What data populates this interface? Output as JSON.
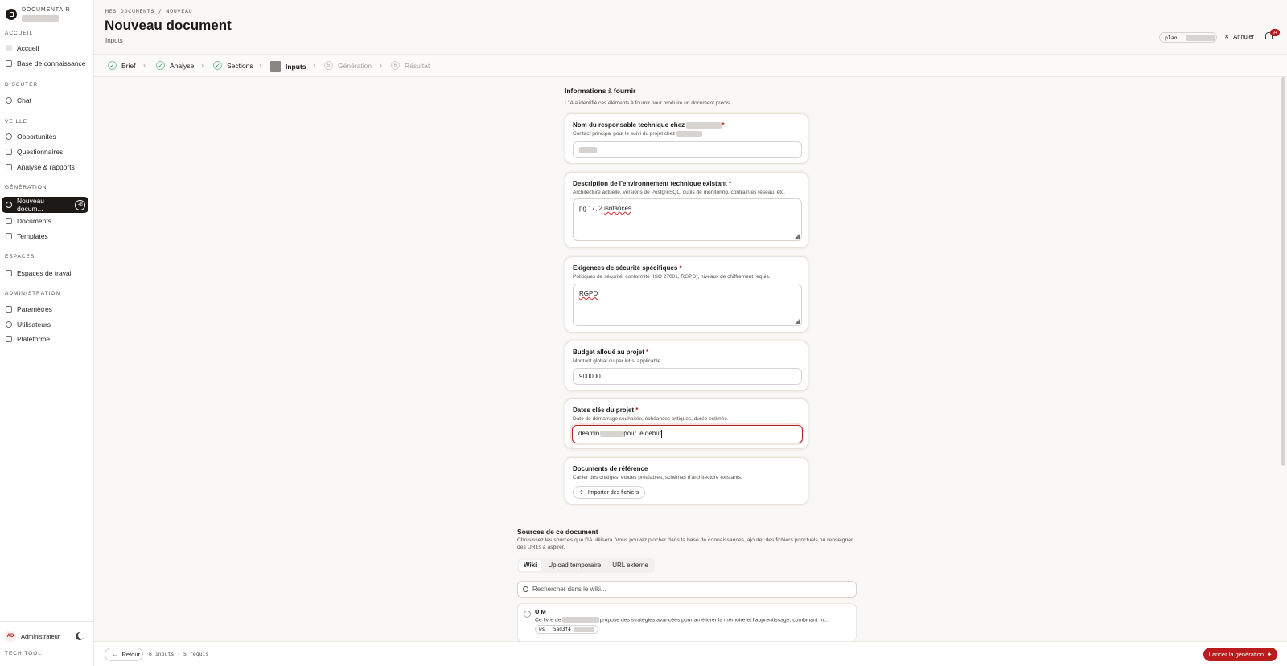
{
  "brand": {
    "name": "DOCUMENTAIR"
  },
  "sidebar": {
    "sections": [
      {
        "title": "ACCUEIL",
        "items": [
          {
            "label": "Accueil"
          },
          {
            "label": "Base de connaissance"
          }
        ]
      },
      {
        "title": "DISCUTER",
        "items": [
          {
            "label": "Chat"
          }
        ]
      },
      {
        "title": "VEILLE",
        "items": [
          {
            "label": "Opportunités"
          },
          {
            "label": "Questionnaires"
          },
          {
            "label": "Analyse & rapports"
          }
        ]
      },
      {
        "title": "GÉNÉRATION",
        "items": [
          {
            "label": "Nouveau docum...",
            "badge": "+8",
            "active": true
          },
          {
            "label": "Documents"
          },
          {
            "label": "Templates"
          }
        ]
      },
      {
        "title": "ESPACES",
        "items": [
          {
            "label": "Espaces de travail"
          }
        ]
      },
      {
        "title": "ADMINISTRATION",
        "items": [
          {
            "label": "Paramètres"
          },
          {
            "label": "Utilisateurs"
          },
          {
            "label": "Plateforme"
          }
        ]
      }
    ],
    "user": {
      "initials": "AD",
      "name": "Administrateur"
    },
    "footer_label": "TECH TOOL"
  },
  "header": {
    "breadcrumb": "MES DOCUMENTS / NOUVEAU",
    "title": "Nouveau document",
    "subtitle": "Inputs",
    "plan_label": "plan ·",
    "cancel_label": "Annuler",
    "notif_badge": "9+"
  },
  "stepper": {
    "steps": [
      {
        "label": "Brief",
        "state": "done"
      },
      {
        "label": "Analyse",
        "state": "done"
      },
      {
        "label": "Sections",
        "state": "done"
      },
      {
        "label": "Inputs",
        "state": "current"
      },
      {
        "label": "Génération",
        "state": "pending",
        "num": "5"
      },
      {
        "label": "Résultat",
        "state": "pending",
        "num": "6"
      }
    ]
  },
  "form": {
    "heading": "Informations à fournir",
    "subheading": "L'IA a identifié ces éléments à fournir pour produire un document précis.",
    "fields": [
      {
        "label": "Nom du responsable technique chez",
        "required": true,
        "description": "Contact principal pour le suivi du projet chez",
        "value": ""
      },
      {
        "label": "Description de l'environnement technique existant",
        "required": true,
        "description": "Architecture actuelle, versions de PostgreSQL, outils de monitoring, contraintes réseau, etc.",
        "value_a": "pg 17, 2 ",
        "value_b": "isntances"
      },
      {
        "label": "Exigences de sécurité spécifiques",
        "required": true,
        "description": "Politiques de sécurité, conformité (ISO 27001, RGPD), niveaux de chiffrement requis.",
        "value": "RGPD"
      },
      {
        "label": "Budget alloué au projet",
        "required": true,
        "description": "Montant global ou par lot si applicable.",
        "value": "900000"
      },
      {
        "label": "Dates clés du projet",
        "required": true,
        "description": "Date de démarrage souhaitée, échéances critiques, durée estimée.",
        "value_a": "deamin",
        "value_b": "pour le debut"
      },
      {
        "label": "Documents de référence",
        "required": false,
        "description": "Cahier des charges, études préalables, schémas d'architecture existants.",
        "button": "Importer des fichiers"
      }
    ],
    "required_mark": "*"
  },
  "sources": {
    "title": "Sources de ce document",
    "description": "Choisissez les sources que l'IA utilisera. Vous pouvez piocher dans la base de connaissances, ajouter des fichiers ponctuels ou renseigner des URLs à aspirer.",
    "tabs": [
      "Wiki",
      "Upload temporaire",
      "URL externe"
    ],
    "search_placeholder": "Rechercher dans le wiki...",
    "items": [
      {
        "title": "U M",
        "desc_a": "Ce livre de",
        "desc_b": "propose des stratégies avancées pour améliorer la mémoire et l'apprentissage, combinant m...",
        "chip": "ws · 5ad3f4"
      }
    ]
  },
  "footer": {
    "back_label": "Retour",
    "status": "6 inputs · 5 requis",
    "launch_label": "Lancer la génération"
  },
  "colors": {
    "accent": "#b91c1c",
    "success": "#15803d",
    "dark": "#1c1917"
  }
}
